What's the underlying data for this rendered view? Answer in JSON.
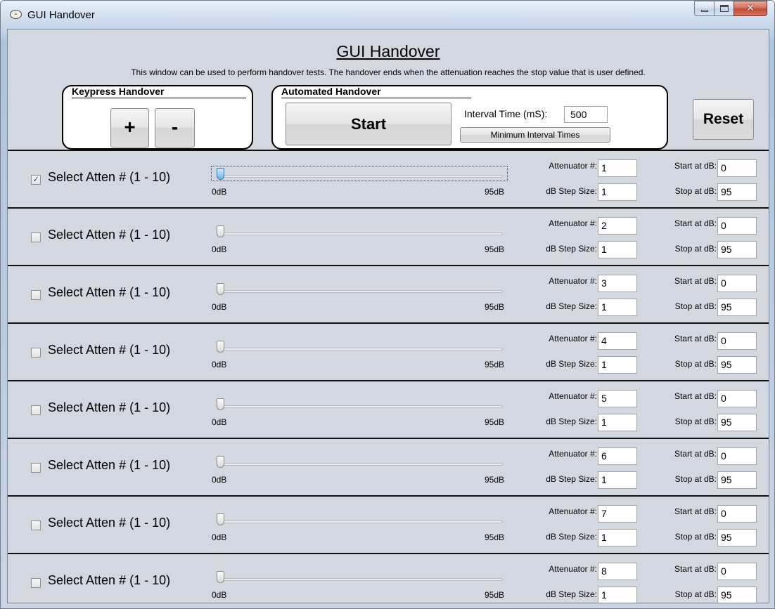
{
  "window": {
    "title": "GUI Handover",
    "app_icon": "app-logo-icon"
  },
  "header": {
    "title": "GUI Handover",
    "subtitle": "This window can be used to perform handover tests.  The handover ends when the attenuation reaches the stop value that is user defined."
  },
  "keypress": {
    "title": "Keypress Handover",
    "plus_label": "+",
    "minus_label": "-"
  },
  "automated": {
    "title": "Automated Handover",
    "start_label": "Start",
    "interval_label": "Interval Time (mS):",
    "interval_value": "500",
    "min_interval_label": "Minimum Interval Times"
  },
  "reset_label": "Reset",
  "labels": {
    "select": "Select Atten # (1 - 10)",
    "slider_min": "0dB",
    "slider_max": "95dB",
    "attenuator": "Attenuator #:",
    "step": "dB Step Size:",
    "start": "Start at dB:",
    "stop": "Stop at dB:"
  },
  "rows": [
    {
      "checked": true,
      "check_glyph": "✓",
      "attenuator": "1",
      "step": "1",
      "start": "0",
      "stop": "95"
    },
    {
      "checked": false,
      "check_glyph": "",
      "attenuator": "2",
      "step": "1",
      "start": "0",
      "stop": "95"
    },
    {
      "checked": false,
      "check_glyph": "",
      "attenuator": "3",
      "step": "1",
      "start": "0",
      "stop": "95"
    },
    {
      "checked": false,
      "check_glyph": "",
      "attenuator": "4",
      "step": "1",
      "start": "0",
      "stop": "95"
    },
    {
      "checked": false,
      "check_glyph": "",
      "attenuator": "5",
      "step": "1",
      "start": "0",
      "stop": "95"
    },
    {
      "checked": false,
      "check_glyph": "",
      "attenuator": "6",
      "step": "1",
      "start": "0",
      "stop": "95"
    },
    {
      "checked": false,
      "check_glyph": "",
      "attenuator": "7",
      "step": "1",
      "start": "0",
      "stop": "95"
    },
    {
      "checked": false,
      "check_glyph": "",
      "attenuator": "8",
      "step": "1",
      "start": "0",
      "stop": "95"
    }
  ]
}
